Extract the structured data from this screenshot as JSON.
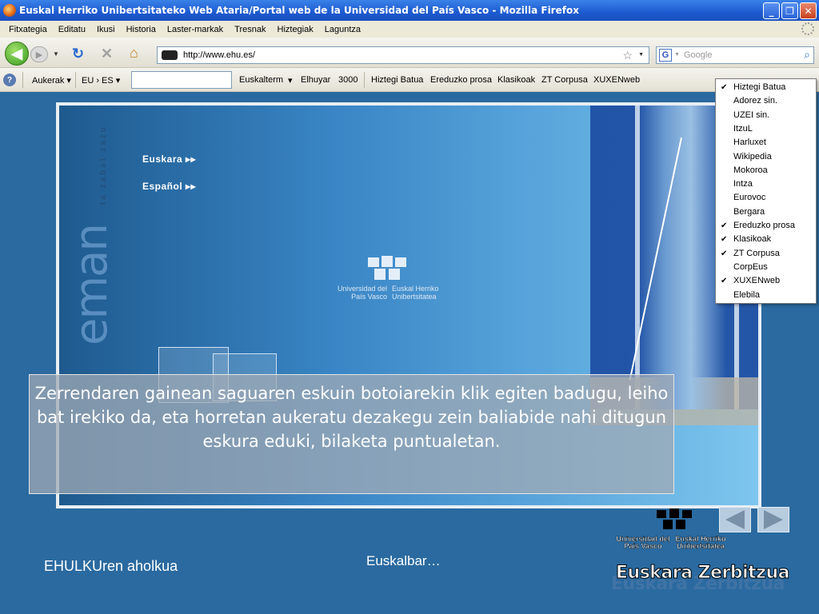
{
  "window": {
    "title": "Euskal Herriko Unibertsitateko Web Ataria/Portal web de la Universidad del País Vasco - Mozilla Firefox",
    "minimize": "_",
    "maximize": "❐",
    "close": "✕"
  },
  "menu": [
    "Fitxategia",
    "Editatu",
    "Ikusi",
    "Historia",
    "Laster-markak",
    "Tresnak",
    "Hiztegiak",
    "Laguntza"
  ],
  "nav": {
    "back": "◀",
    "forward": "▶",
    "url": "http://www.ehu.es/",
    "search_placeholder": "Google",
    "search_engine": "G"
  },
  "euskalbar": {
    "help": "?",
    "aukerak": "Aukerak ▾",
    "lang": "EU › ES ▾",
    "items": [
      "Euskalterm",
      "▾",
      "Elhuyar",
      "3000",
      "Hiztegi Batua",
      "Ereduzko prosa",
      "Klasikoak",
      "ZT Corpusa",
      "XUXENweb"
    ]
  },
  "dropdown": [
    {
      "label": "Hiztegi Batua",
      "checked": true
    },
    {
      "label": "Adorez sin.",
      "checked": false
    },
    {
      "label": "UZEI sin.",
      "checked": false
    },
    {
      "label": "ItzuL",
      "checked": false
    },
    {
      "label": "Harluxet",
      "checked": false
    },
    {
      "label": "Wikipedia",
      "checked": false
    },
    {
      "label": "Mokoroa",
      "checked": false
    },
    {
      "label": "Intza",
      "checked": false
    },
    {
      "label": "Eurovoc",
      "checked": false
    },
    {
      "label": "Bergara",
      "checked": false
    },
    {
      "label": "Ereduzko prosa",
      "checked": true
    },
    {
      "label": "Klasikoak",
      "checked": true
    },
    {
      "label": "ZT Corpusa",
      "checked": true
    },
    {
      "label": "CorpEus",
      "checked": false
    },
    {
      "label": "XUXENweb",
      "checked": true
    },
    {
      "label": "Elebila",
      "checked": false
    }
  ],
  "site": {
    "eman": "eman",
    "tagline": "ta zabal zazu",
    "lang_eu": "Euskara ▸▸",
    "lang_es": "Español ▸▸",
    "logo_left": "Universidad del País Vasco",
    "logo_right": "Euskal Herriko Unibertsitatea"
  },
  "caption": "Zerrendaren gainean saguaren eskuin botoiarekin klik egiten badugu, leiho bat irekiko da, eta horretan aukeratu dezakegu zein baliabide nahi ditugun eskura eduki, bilaketa puntualetan.",
  "footer": {
    "left": "EHULKUren aholkua",
    "middle": "Euskalbar…",
    "uni_left": "Universidad del País Vasco",
    "uni_right": "Euskal Herriko Unibertsitatea",
    "service": "Euskara Zerbitzua"
  }
}
